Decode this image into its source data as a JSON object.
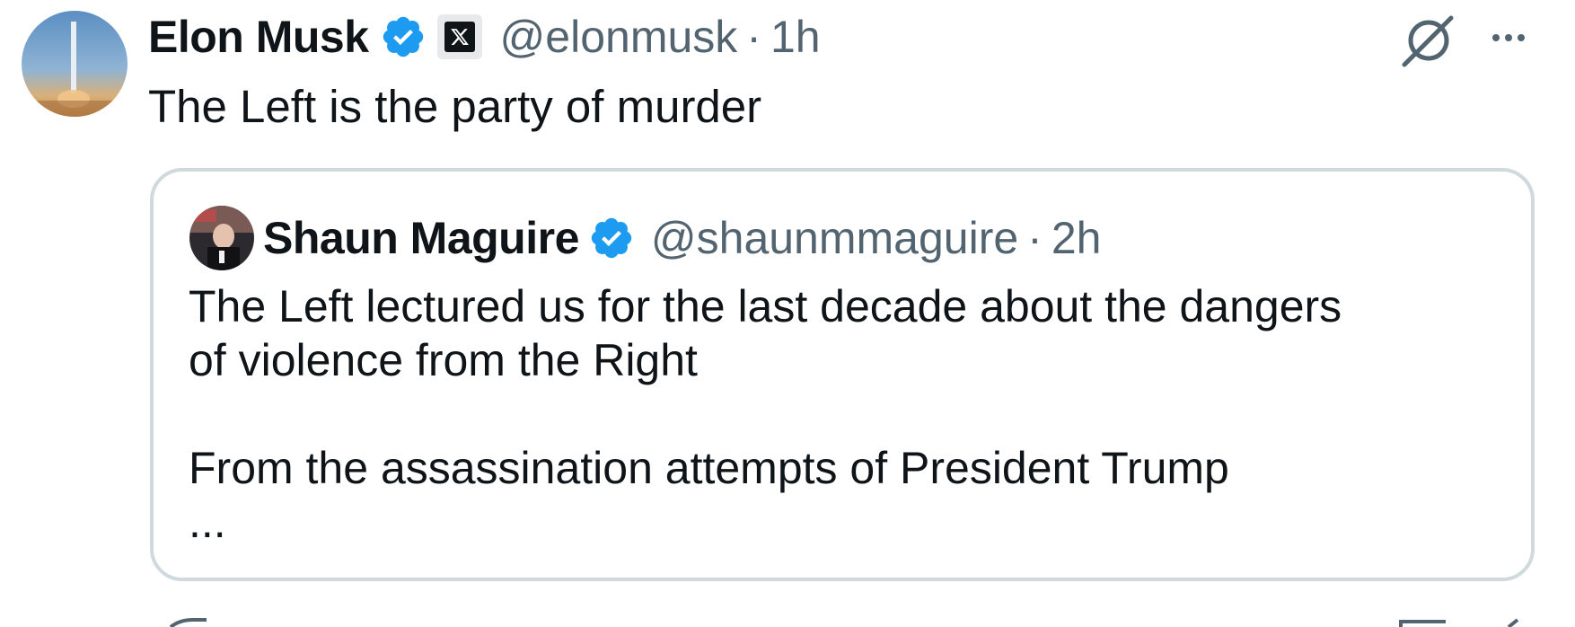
{
  "post": {
    "author_name": "Elon Musk",
    "handle": "@elonmusk",
    "separator": "·",
    "time": "1h",
    "affiliation_icon": "x-logo-icon",
    "verified_icon": "verified-badge-icon",
    "text": "The Left is the party of murder"
  },
  "toolbar": {
    "grok_icon": "grok-icon",
    "more_icon": "more-options-icon"
  },
  "quoted_post": {
    "author_name": "Shaun Maguire",
    "handle": "@shaunmmaguire",
    "separator": "·",
    "time": "2h",
    "verified_icon": "verified-badge-icon",
    "lines": [
      "The Left lectured us for the last decade about the dangers",
      "of violence from the Right",
      "",
      "From the assassination attempts of President Trump"
    ],
    "ellipsis": "..."
  },
  "colors": {
    "verified_blue": "#1d9bf0",
    "secondary_text": "#536471",
    "border": "#cfd9de"
  }
}
